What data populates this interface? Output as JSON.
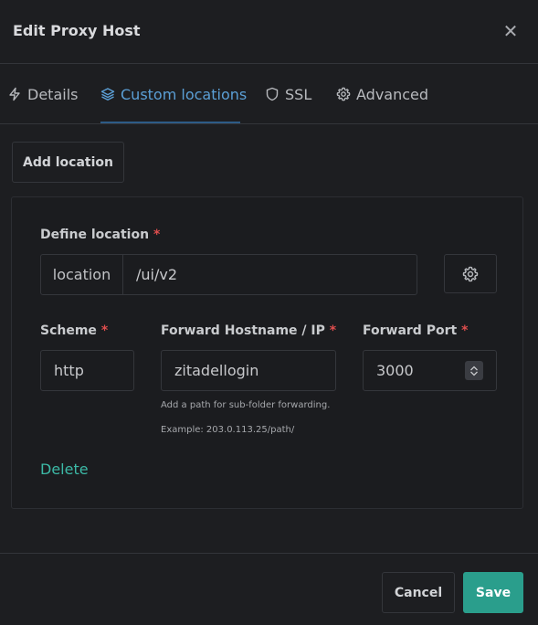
{
  "modal": {
    "title": "Edit Proxy Host",
    "close_icon": "close-icon"
  },
  "tabs": [
    {
      "label": "Details",
      "icon": "lightning-icon",
      "active": false
    },
    {
      "label": "Custom locations",
      "icon": "layers-icon",
      "active": true
    },
    {
      "label": "SSL",
      "icon": "shield-icon",
      "active": false
    },
    {
      "label": "Advanced",
      "icon": "gear-icon",
      "active": false
    }
  ],
  "actions": {
    "add_location": "Add location"
  },
  "location": {
    "define_label": "Define location",
    "required_mark": "*",
    "prefix": "location",
    "path_value": "/ui/v2",
    "settings_icon": "gear-icon",
    "scheme": {
      "label": "Scheme",
      "value": "http"
    },
    "hostname": {
      "label": "Forward Hostname / IP",
      "value": "zitadellogin",
      "help_line1": "Add a path for sub-folder forwarding.",
      "help_line2": "Example: 203.0.113.25/path/"
    },
    "port": {
      "label": "Forward Port",
      "value": "3000"
    },
    "delete": "Delete"
  },
  "footer": {
    "cancel": "Cancel",
    "save": "Save"
  },
  "colors": {
    "accent_blue": "#5b9fd6",
    "accent_teal": "#2a9e8c",
    "delete_teal": "#3cb9a6",
    "required_red": "#e04e4e",
    "background": "#1d1e21"
  }
}
